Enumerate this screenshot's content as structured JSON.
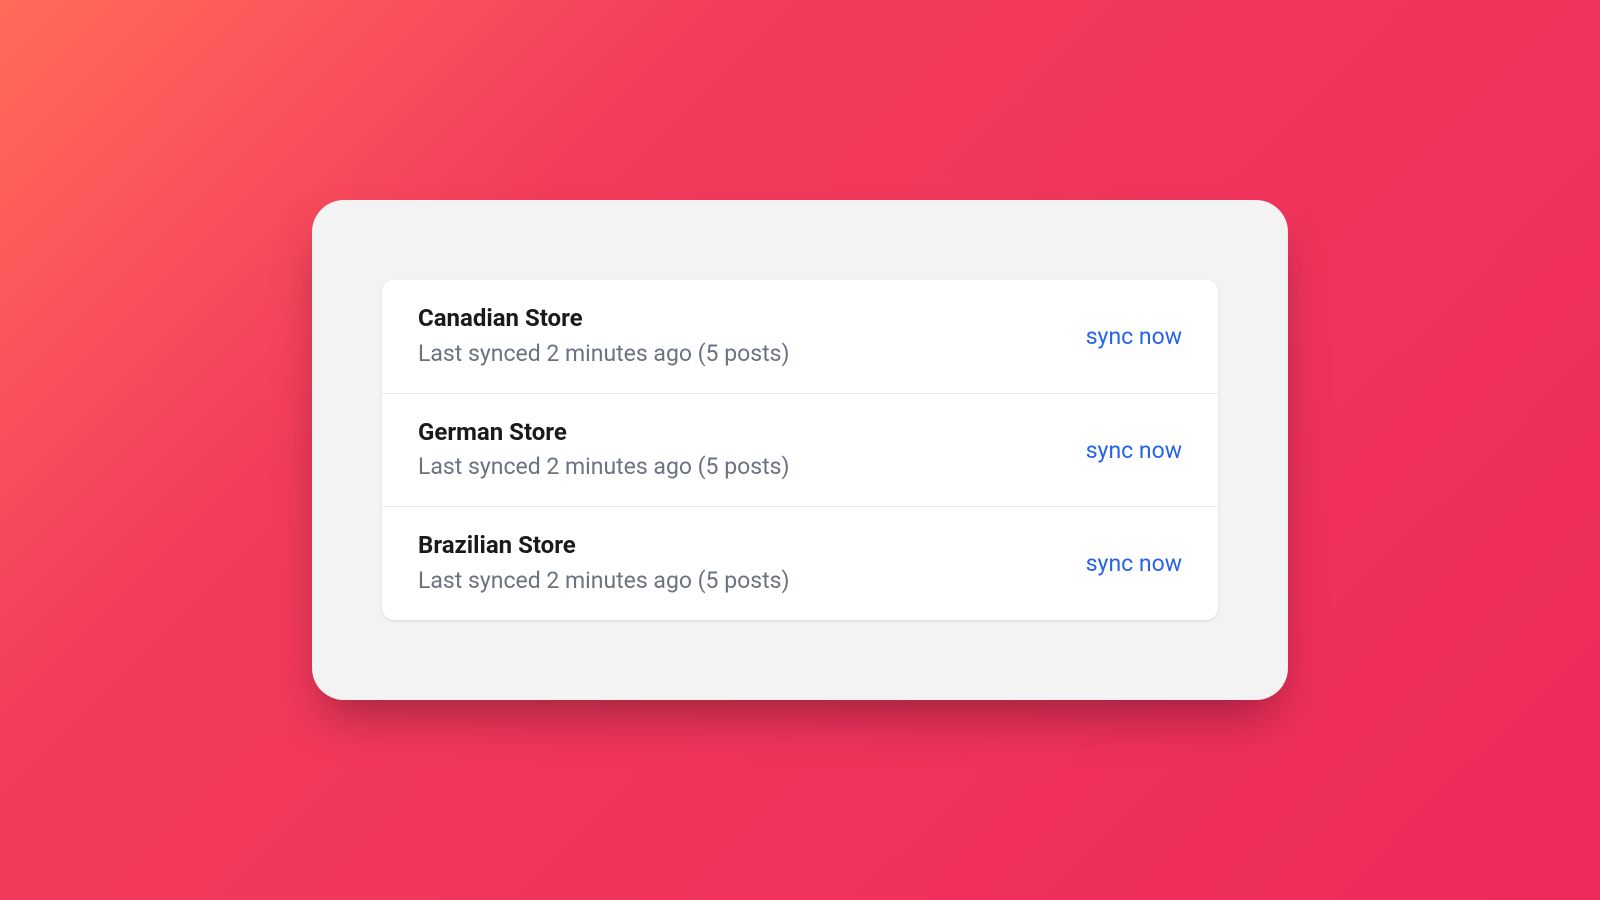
{
  "stores": [
    {
      "name": "Canadian Store",
      "status": "Last synced 2 minutes ago (5 posts)",
      "action": "sync now"
    },
    {
      "name": "German Store",
      "status": "Last synced 2 minutes ago (5 posts)",
      "action": "sync now"
    },
    {
      "name": "Brazilian Store",
      "status": "Last synced 2 minutes ago (5 posts)",
      "action": "sync now"
    }
  ]
}
